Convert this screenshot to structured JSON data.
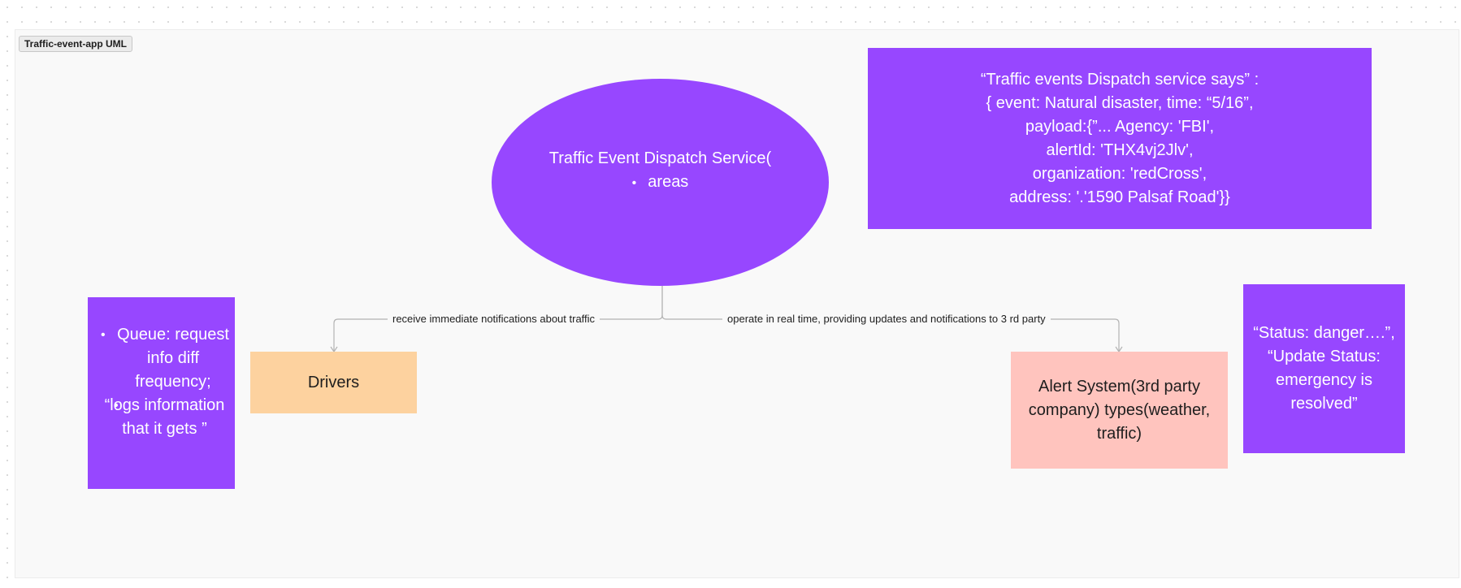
{
  "frame": {
    "label": "Traffic-event-app UML"
  },
  "nodes": {
    "dispatch_service": {
      "title": "Traffic Event Dispatch Service(",
      "bullets": [
        "areas"
      ]
    },
    "payload_note": {
      "lines": [
        "“Traffic events Dispatch service says” :",
        "{ event: Natural disaster, time: “5/16”,",
        "payload:{”...  Agency: 'FBI',",
        "alertId: 'THX4vj2Jlv',",
        "organization: 'redCross',",
        "address: '.'1590 Palsaf Road'}}"
      ]
    },
    "status_note": {
      "text": "“Status: danger….”, “Update Status: emergency is resolved”"
    },
    "queue_note": {
      "bullets": [
        "Queue: request info diff frequency;",
        "“logs information that it gets ”"
      ]
    },
    "drivers": {
      "label": "Drivers"
    },
    "alert_system": {
      "label": "Alert System(3rd party company) types(weather, traffic)"
    }
  },
  "edges": {
    "to_drivers": {
      "label": "receive immediate notifications about traffic"
    },
    "to_alert_system": {
      "label": "operate in real time, providing updates and notifications to 3 rd party"
    }
  },
  "colors": {
    "purple": "#9747ff",
    "orange": "#fdd29f",
    "pink": "#ffc4be",
    "connector": "#b3b3b3"
  }
}
